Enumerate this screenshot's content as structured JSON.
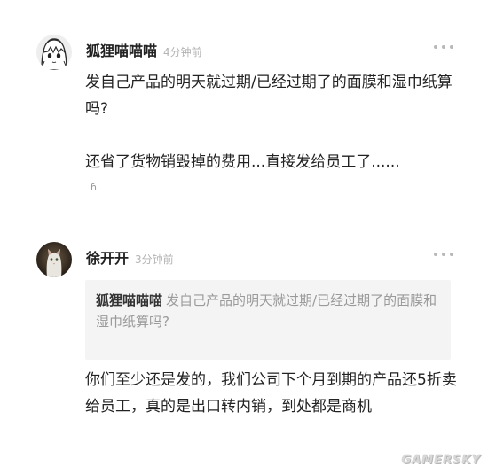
{
  "comments": [
    {
      "username": "狐狸喵喵喵",
      "time": "4分钟前",
      "avatar_icon": "anime-girl-avatar-icon",
      "paragraphs": [
        "发自己产品的明天就过期/已经过期了的面膜和湿巾纸算吗?",
        "还省了货物销毁掉的费用...直接发给员工了......"
      ],
      "reply_glyph": "ɦ"
    },
    {
      "username": "徐开开",
      "time": "3分钟前",
      "avatar_icon": "cat-photo-avatar-icon",
      "quote": {
        "author": "狐狸喵喵喵",
        "text": "发自己产品的明天就过期/已经过期了的面膜和湿巾纸算吗?"
      },
      "paragraphs": [
        "你们至少还是发的，我们公司下个月到期的产品还5折卖给员工，真的是出口转内销，到处都是商机"
      ]
    }
  ],
  "watermark": "GAMERSKY",
  "colors": {
    "text": "#222222",
    "timestamp": "#b3b3b3",
    "quote_bg": "#f4f4f4",
    "quote_text": "#9a9a9a"
  }
}
